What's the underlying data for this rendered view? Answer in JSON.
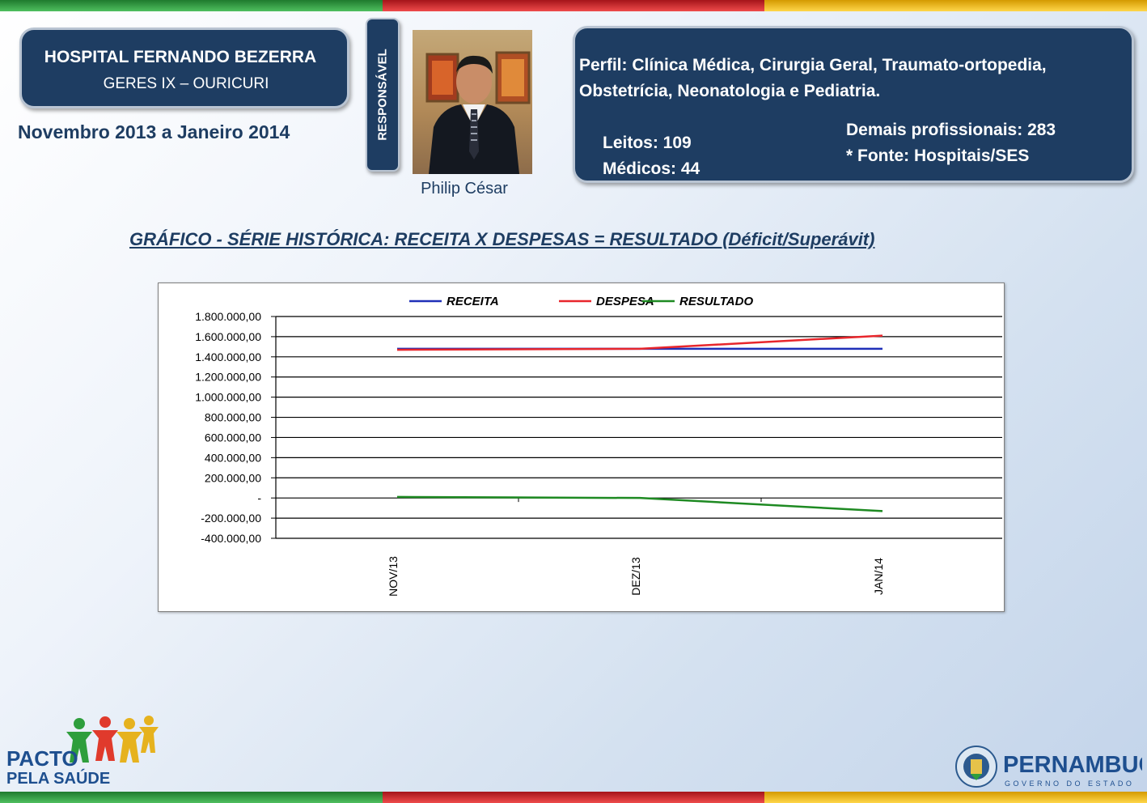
{
  "header": {
    "hospital_name": "HOSPITAL FERNANDO BEZERRA",
    "geres": "GERES IX – OURICURI",
    "period": "Novembro 2013 a Janeiro 2014",
    "responsible_label": "RESPONSÁVEL",
    "responsible_name": "Philip César"
  },
  "profile": {
    "text": "Perfil: Clínica Médica, Cirurgia Geral, Traumato-ortopedia, Obstetrícia, Neonatologia e Pediatria.",
    "beds": "Leitos: 109",
    "doctors": "Médicos: 44",
    "other_staff": "Demais profissionais: 283",
    "source": "* Fonte: Hospitais/SES"
  },
  "chart_title": "GRÁFICO - SÉRIE HISTÓRICA: RECEITA X DESPESAS = RESULTADO (Déficit/Superávit)",
  "chart_data": {
    "type": "line",
    "categories": [
      "NOV/13",
      "DEZ/13",
      "JAN/14"
    ],
    "series": [
      {
        "name": "RECEITA",
        "color": "#1f2fb8",
        "values": [
          1480000,
          1480000,
          1480000
        ]
      },
      {
        "name": "DESPESA",
        "color": "#e8262c",
        "values": [
          1470000,
          1480000,
          1610000
        ]
      },
      {
        "name": "RESULTADO",
        "color": "#1e8a22",
        "values": [
          10000,
          0,
          -130000
        ]
      }
    ],
    "ylim": [
      -400000,
      1800000
    ],
    "yticks": [
      1800000,
      1600000,
      1400000,
      1200000,
      1000000,
      800000,
      600000,
      400000,
      200000,
      0,
      -200000,
      -400000
    ],
    "ytick_labels": [
      "1.800.000,00",
      "1.600.000,00",
      "1.400.000,00",
      "1.200.000,00",
      "1.000.000,00",
      "800.000,00",
      "600.000,00",
      "400.000,00",
      "200.000,00",
      "-",
      "-200.000,00",
      "-400.000,00"
    ],
    "legend_position": "top",
    "grid": true
  },
  "logos": {
    "pacto_line1": "PACTO",
    "pacto_line2": "PELA SAÚDE",
    "state_name": "PERNAMBUCO",
    "state_sub": "GOVERNO DO ESTADO"
  },
  "colors": {
    "panel": "#1e3d62",
    "receita": "#1f2fb8",
    "despesa": "#e8262c",
    "resultado": "#1e8a22"
  }
}
